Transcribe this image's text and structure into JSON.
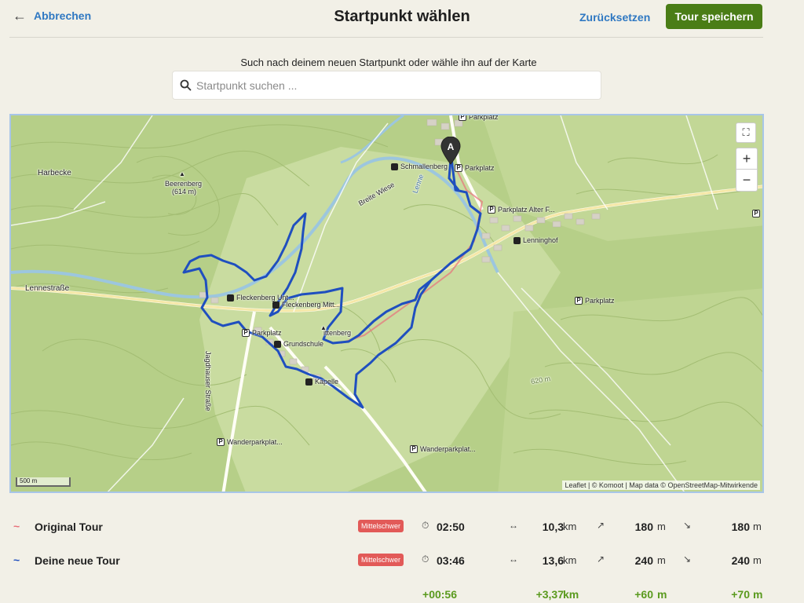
{
  "header": {
    "cancel_label": "Abbrechen",
    "title": "Startpunkt wählen",
    "reset_label": "Zurücksetzen",
    "save_label": "Tour speichern"
  },
  "search": {
    "instruction": "Such nach deinem neuen Startpunkt oder wähle ihn auf der Karte",
    "placeholder": "Startpunkt suchen ..."
  },
  "map": {
    "marker_label": "A",
    "labels": {
      "harbecke": "Harbecke",
      "beerenberg": "Beerenberg",
      "beerenberg_elev": "(614 m)",
      "breite_wiese": "Breite Wiese",
      "lenne": "Lenne",
      "lennestrasse": "Lennestraße",
      "jagdhauser": "Jagdhauser Straße",
      "mittenberg": "ittenberg",
      "lenninghof": "Lenninghof",
      "elev_m": "620 m"
    },
    "pois": {
      "parkplatz_top": "Parkplatz",
      "schmallenberg": "Schmallenberg",
      "parkplatz_a": "Parkplatz",
      "parkplatz_alter": "Parkplatz Alter F...",
      "fleckenberg_unt": "Fleckenberg Unt...",
      "fleckenberg_mitt": "Fleckenberg Mitt...",
      "parkplatz_left": "Parkplatz",
      "grundschule": "Grundschule",
      "kapelle": "Kapelle",
      "parkplatz_right": "Parkplatz",
      "wanderparkplatz_1": "Wanderparkplat...",
      "wanderparkplatz_2": "Wanderparkplat..."
    },
    "scale": "500 m",
    "attribution": "Leaflet | © Komoot | Map data © OpenStreetMap-Mitwirkende",
    "zoom_in": "+",
    "zoom_out": "−"
  },
  "tours": [
    {
      "name": "Original Tour",
      "difficulty": "Mittelschwer",
      "color": "#e8707a",
      "duration": "02:50",
      "distance": "10,3",
      "distance_unit": "km",
      "ascent": "180",
      "ascent_unit": "m",
      "descent": "180",
      "descent_unit": "m"
    },
    {
      "name": "Deine neue Tour",
      "difficulty": "Mittelschwer",
      "color": "#1f4fbf",
      "duration": "03:46",
      "distance": "13,6",
      "distance_unit": "km",
      "ascent": "240",
      "ascent_unit": "m",
      "descent": "240",
      "descent_unit": "m"
    }
  ],
  "deltas": {
    "duration": "+00:56",
    "distance": "+3,37",
    "distance_unit": "km",
    "ascent": "+60",
    "ascent_unit": "m",
    "descent": "+70",
    "descent_unit": "m"
  },
  "icons": {
    "back": "arrow-left-icon",
    "search": "search-icon",
    "fullscreen": "fullscreen-icon",
    "duration": "stopwatch-icon",
    "distance": "horizontal-arrows-icon",
    "ascent": "arrow-up-right-icon",
    "descent": "arrow-down-right-icon"
  },
  "colors": {
    "accent": "#2f78c2",
    "save_button": "#4a7d16",
    "badge": "#e25a58",
    "route": "#1f4fbf",
    "delta": "#5a9a1e"
  }
}
